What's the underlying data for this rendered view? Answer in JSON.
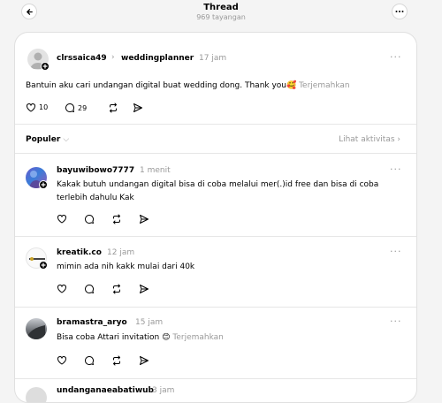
{
  "header": {
    "title": "Thread",
    "views": "969 tayangan"
  },
  "post": {
    "author": "clrssaica49",
    "reply_to": "weddingplanner",
    "time": "17 jam",
    "text": "Bantuin aku cari undangan digital buat wedding dong. Thank you🥰",
    "translate": "Terjemahkan",
    "likes": "10",
    "comments": "29"
  },
  "sort": {
    "label": "Populer",
    "activity": "Lihat aktivitas"
  },
  "replies": [
    {
      "author": "bayuwibowo7777",
      "time": "1 menit",
      "text_line1": "Kakak butuh undangan digital bisa di coba melalui mer(.)id free dan bisa di coba",
      "text_line2": "terlebih dahulu Kak"
    },
    {
      "author": "kreatik.co",
      "time": "12 jam",
      "text_line1": "mimin ada nih kakk mulai dari 40k"
    },
    {
      "author": "bramastra_aryo",
      "time": "15 jam",
      "text_line1": "Bisa coba Attari invitation 😊",
      "translate": "Terjemahkan"
    },
    {
      "author": "undanganaeabatiwub",
      "time": "3 jam"
    }
  ],
  "colors": {
    "background": "#f4f4f4",
    "card": "#ffffff",
    "muted": "#999999"
  }
}
